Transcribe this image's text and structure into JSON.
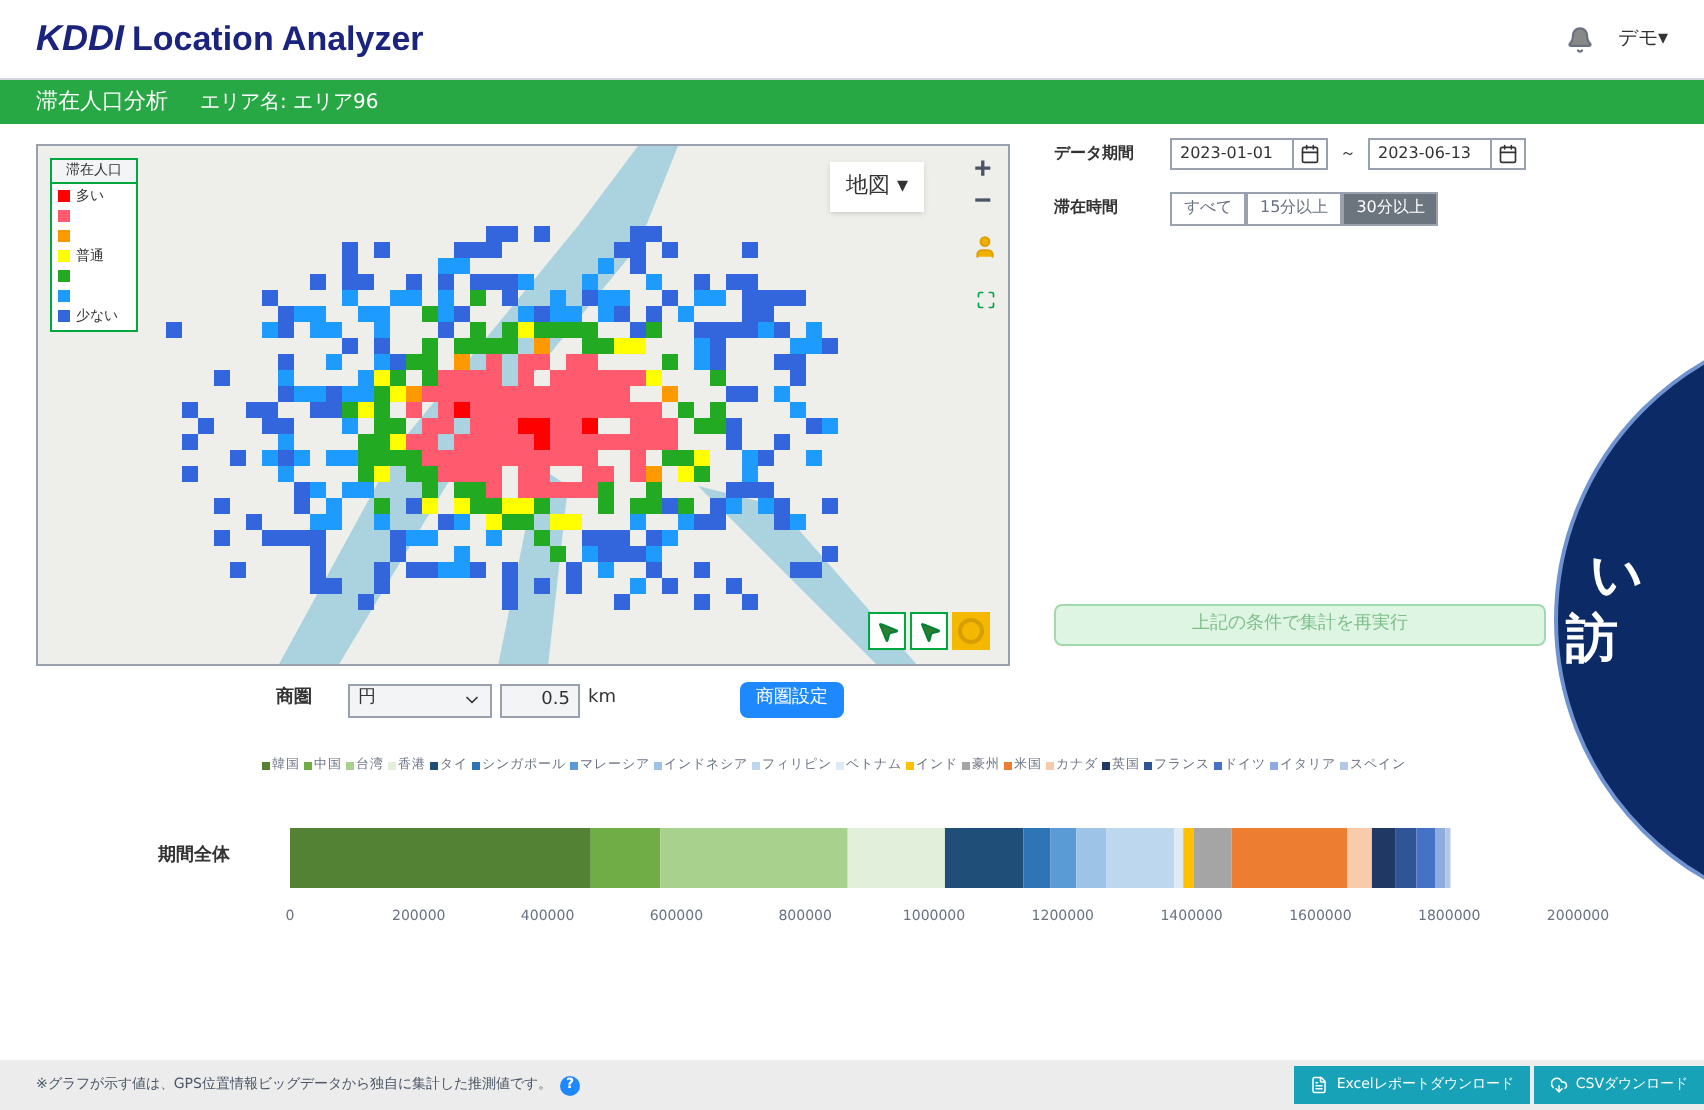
{
  "header": {
    "logo_brand": "KDDI",
    "logo_text": "Location Analyzer",
    "user_menu": "デモ▾"
  },
  "title_bar": {
    "title": "滞在人口分析",
    "area": "エリア名: エリア96"
  },
  "map": {
    "layer_button": "地図 ▾",
    "zoom_in": "+",
    "zoom_out": "−",
    "legend": {
      "title": "滞在人口",
      "items": [
        {
          "label": "多い",
          "color": "#ff0000"
        },
        {
          "color": "#ff5a6e"
        },
        {
          "color": "#ff9900"
        },
        {
          "label": "普通",
          "color": "#ffff00"
        },
        {
          "color": "#22aa22"
        },
        {
          "color": "#1e9bff"
        },
        {
          "label": "少ない",
          "color": "#3366dd"
        }
      ]
    },
    "tools": [
      {
        "kind": "add",
        "selected": false
      },
      {
        "kind": "remove",
        "selected": false
      },
      {
        "kind": "circle",
        "selected": true
      }
    ]
  },
  "trade_area": {
    "label": "商圏",
    "shape": "円",
    "radius": "0.5",
    "unit": "km",
    "button": "商圏設定"
  },
  "filters": {
    "period_label": "データ期間",
    "start": "2023-01-01",
    "separator": "～",
    "end": "2023-06-13",
    "stay_label": "滞在時間",
    "stay_options": [
      {
        "label": "すべて",
        "selected": false
      },
      {
        "label": "15分以上",
        "selected": false
      },
      {
        "label": "30分以上",
        "selected": true
      }
    ],
    "rerun_button": "上記の条件で集計を再実行"
  },
  "overlay": {
    "line_1": "い",
    "line_2": "訪"
  },
  "chart": {
    "chart_data": {
      "type": "bar",
      "orientation": "horizontal",
      "stacked": true,
      "legend": true,
      "categories": [
        "期間全体"
      ],
      "xlim": [
        0,
        2000000
      ],
      "xticks": [
        0,
        200000,
        400000,
        600000,
        800000,
        1000000,
        1200000,
        1400000,
        1600000,
        1800000,
        2000000
      ],
      "series": [
        {
          "name": "韓国",
          "color": "#548235",
          "values": [
            467000
          ]
        },
        {
          "name": "中国",
          "color": "#70ad47",
          "values": [
            108000
          ]
        },
        {
          "name": "台湾",
          "color": "#a9d18e",
          "values": [
            291000
          ]
        },
        {
          "name": "香港",
          "color": "#e2efda",
          "values": [
            151000
          ]
        },
        {
          "name": "タイ",
          "color": "#1f4e79",
          "values": [
            122000
          ]
        },
        {
          "name": "シンガポール",
          "color": "#2e75b6",
          "values": [
            42000
          ]
        },
        {
          "name": "マレーシア",
          "color": "#5b9bd5",
          "values": [
            40000
          ]
        },
        {
          "name": "インドネシア",
          "color": "#9dc3e6",
          "values": [
            47000
          ]
        },
        {
          "name": "フィリピン",
          "color": "#bdd7ee",
          "values": [
            105000
          ]
        },
        {
          "name": "ベトナム",
          "color": "#deebf7",
          "values": [
            14000
          ]
        },
        {
          "name": "インド",
          "color": "#ffc000",
          "values": [
            16000
          ]
        },
        {
          "name": "豪州",
          "color": "#a5a5a5",
          "values": [
            59000
          ]
        },
        {
          "name": "米国",
          "color": "#ed7d31",
          "values": [
            180000
          ]
        },
        {
          "name": "カナダ",
          "color": "#f8cbad",
          "values": [
            38000
          ]
        },
        {
          "name": "英国",
          "color": "#203864",
          "values": [
            37000
          ]
        },
        {
          "name": "フランス",
          "color": "#2f5597",
          "values": [
            32000
          ]
        },
        {
          "name": "ドイツ",
          "color": "#4472c4",
          "values": [
            29000
          ]
        },
        {
          "name": "イタリア",
          "color": "#8faadc",
          "values": [
            16000
          ]
        },
        {
          "name": "スペイン",
          "color": "#b4c7e7",
          "values": [
            8000
          ]
        }
      ]
    }
  },
  "footer": {
    "note": "※グラフが示す値は、GPS位置情報ビッグデータから独自に集計した推測値です。",
    "help": "?",
    "excel_button": "Excelレポートダウンロード",
    "csv_button": "CSVダウンロード"
  }
}
